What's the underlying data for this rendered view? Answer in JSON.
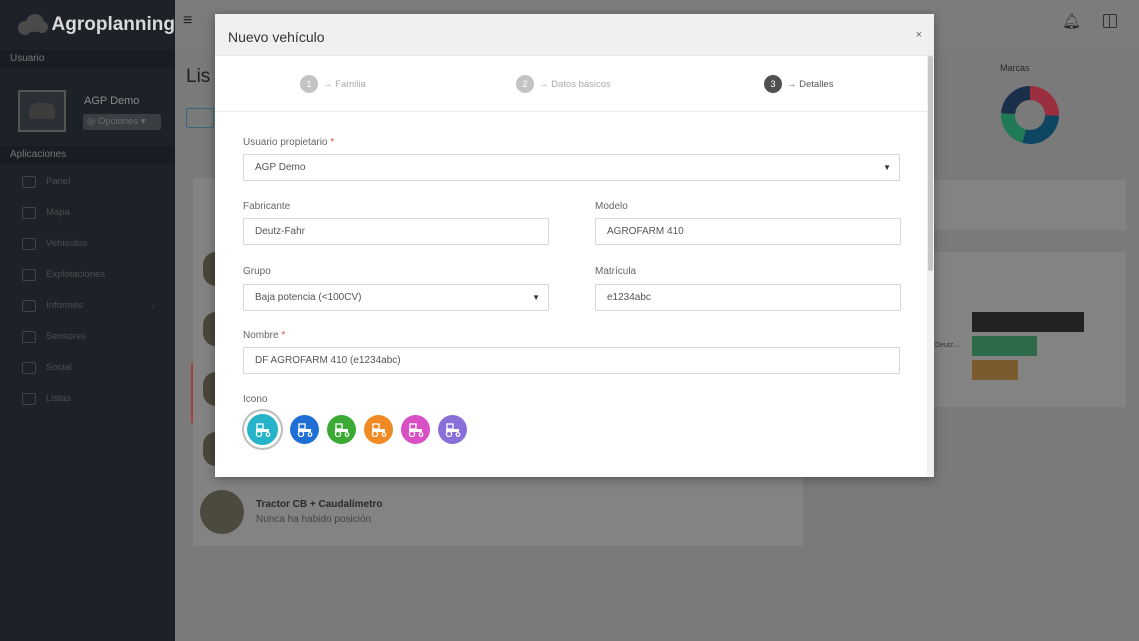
{
  "brand": {
    "name": "Agroplanning"
  },
  "sidebar": {
    "user_section": "Usuario",
    "user_name": "AGP Demo",
    "options_label": "Opciones",
    "apps_section": "Aplicaciones",
    "items": [
      {
        "label": "Panel",
        "icon": "dashboard-icon"
      },
      {
        "label": "Mapa",
        "icon": "map-icon"
      },
      {
        "label": "Vehículos",
        "icon": "vehicles-icon"
      },
      {
        "label": "Explotaciones",
        "icon": "farm-icon"
      },
      {
        "label": "Informes",
        "icon": "reports-icon"
      },
      {
        "label": "Sensores",
        "icon": "sensors-icon"
      },
      {
        "label": "Social",
        "icon": "social-icon"
      },
      {
        "label": "Listas",
        "icon": "lists-icon"
      }
    ]
  },
  "background": {
    "heading": "Lis",
    "last_vehicle": {
      "name": "Tractor CB + Caudalímetro",
      "status": "Nunca ha habido posición"
    },
    "stats_title": "Marcas",
    "bar_label": "Deutz..."
  },
  "modal": {
    "title": "Nuevo vehículo",
    "close": "×",
    "steps": [
      {
        "num": "1",
        "label": "→ Familia"
      },
      {
        "num": "2",
        "label": "→ Datos básicos"
      },
      {
        "num": "3",
        "label": "→ Detalles"
      }
    ],
    "form": {
      "owner_label": "Usuario propietario",
      "owner_value": "AGP Demo",
      "maker_label": "Fabricante",
      "maker_value": "Deutz-Fahr",
      "model_label": "Modelo",
      "model_value": "AGROFARM 410",
      "group_label": "Grupo",
      "group_value": "Baja potencia (<100CV)",
      "plate_label": "Matrícula",
      "plate_value": "e1234abc",
      "name_label": "Nombre",
      "name_value": "DF AGROFARM 410 (e1234abc)",
      "icon_label": "Icono",
      "required_mark": "*"
    },
    "icon_colors": [
      "#26b3c9",
      "#1f6fd6",
      "#3aaa35",
      "#f08a24",
      "#d94fc4",
      "#8b6fd8"
    ]
  }
}
